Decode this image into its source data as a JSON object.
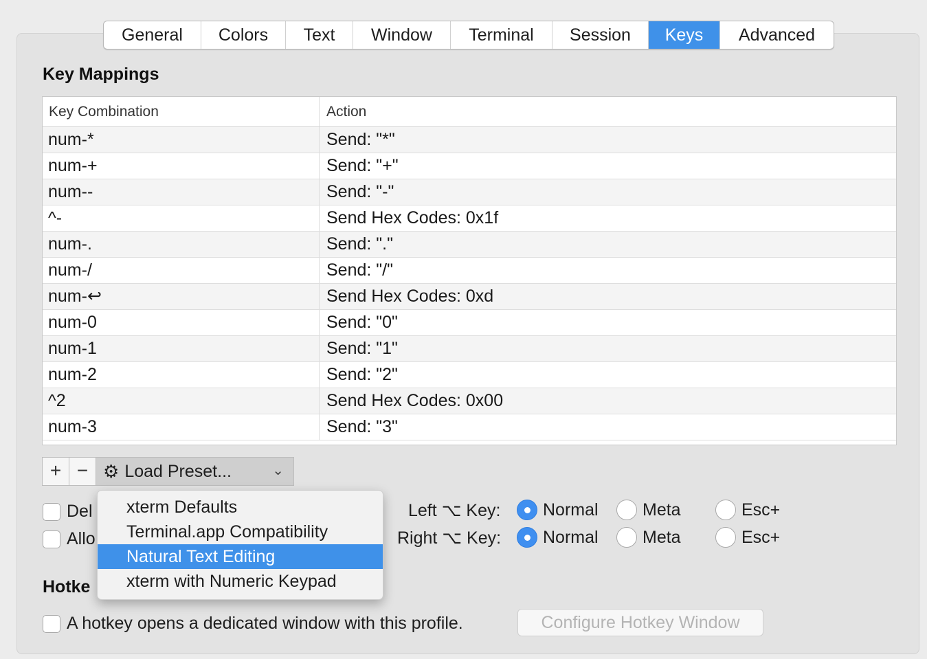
{
  "tabs": [
    {
      "label": "General",
      "active": false
    },
    {
      "label": "Colors",
      "active": false
    },
    {
      "label": "Text",
      "active": false
    },
    {
      "label": "Window",
      "active": false
    },
    {
      "label": "Terminal",
      "active": false
    },
    {
      "label": "Session",
      "active": false
    },
    {
      "label": "Keys",
      "active": true
    },
    {
      "label": "Advanced",
      "active": false
    }
  ],
  "key_mappings": {
    "title": "Key Mappings",
    "columns": {
      "key": "Key Combination",
      "action": "Action"
    },
    "rows": [
      {
        "key": "num-*",
        "action": "Send: \"*\""
      },
      {
        "key": "num-+",
        "action": "Send: \"+\""
      },
      {
        "key": "num--",
        "action": "Send: \"-\""
      },
      {
        "key": "^-",
        "action": "Send Hex Codes: 0x1f"
      },
      {
        "key": "num-.",
        "action": "Send: \".\""
      },
      {
        "key": "num-/",
        "action": "Send: \"/\""
      },
      {
        "key": "num-↩",
        "action": "Send Hex Codes: 0xd"
      },
      {
        "key": "num-0",
        "action": "Send: \"0\""
      },
      {
        "key": "num-1",
        "action": "Send: \"1\""
      },
      {
        "key": "num-2",
        "action": "Send: \"2\""
      },
      {
        "key": "^2",
        "action": "Send Hex Codes: 0x00"
      },
      {
        "key": "num-3",
        "action": "Send: \"3\""
      }
    ]
  },
  "toolbar": {
    "add_label": "+",
    "remove_label": "−",
    "preset_label": "Load Preset...",
    "chevron": "⌄"
  },
  "preset_menu": {
    "items": [
      {
        "label": "xterm Defaults",
        "selected": false
      },
      {
        "label": "Terminal.app Compatibility",
        "selected": false
      },
      {
        "label": "Natural Text Editing",
        "selected": true
      },
      {
        "label": "xterm with Numeric Keypad",
        "selected": false
      }
    ]
  },
  "options": {
    "checkbox1_label": "Del",
    "checkbox2_label": "Allo",
    "left_key_label": "Left ⌥ Key:",
    "right_key_label": "Right ⌥ Key:",
    "radio_normal": "Normal",
    "radio_meta": "Meta",
    "radio_esc": "Esc+",
    "left_selected": "Normal",
    "right_selected": "Normal"
  },
  "hotkey": {
    "title": "Hotke",
    "checkbox_label": "A hotkey opens a dedicated window with this profile.",
    "button_label": "Configure Hotkey Window"
  },
  "colors": {
    "accent": "#3f91e9"
  }
}
